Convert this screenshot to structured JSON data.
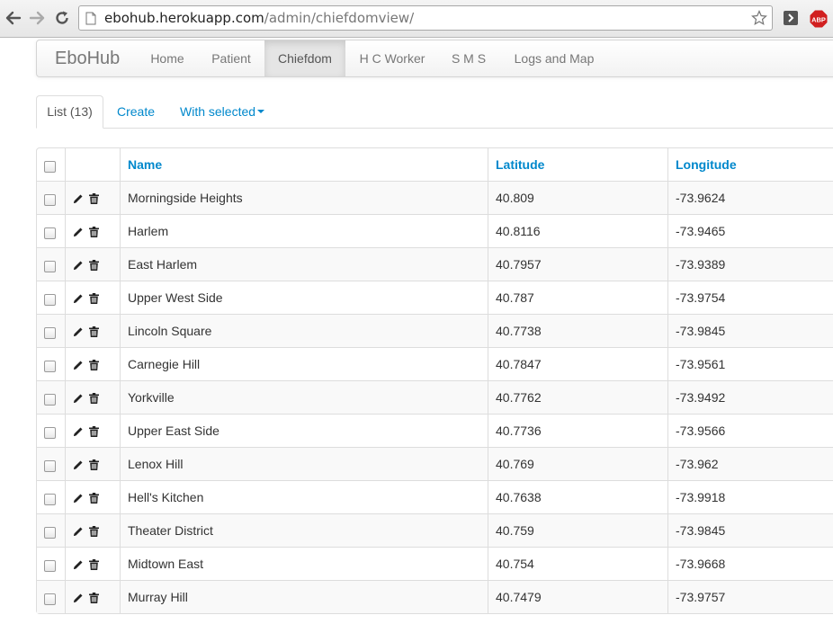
{
  "browser": {
    "url_host": "ebohub.herokuapp.com",
    "url_path": "/admin/chiefdomview/",
    "extension_label": "ABP",
    "icons": {
      "back": "back-arrow-icon",
      "forward": "forward-arrow-icon",
      "reload": "reload-icon",
      "page": "page-icon",
      "bookmark": "star-icon",
      "extension": "extension-icon",
      "adblock": "adblock-icon"
    },
    "colors": {
      "adblock": "#d11f1f"
    }
  },
  "navbar": {
    "brand": "EboHub",
    "items": [
      {
        "label": "Home",
        "active": false
      },
      {
        "label": "Patient",
        "active": false
      },
      {
        "label": "Chiefdom",
        "active": true
      },
      {
        "label": "H C Worker",
        "active": false
      },
      {
        "label": "S M S",
        "active": false
      },
      {
        "label": "Logs and Map",
        "active": false
      }
    ]
  },
  "tabs": {
    "list_label": "List (13)",
    "create_label": "Create",
    "with_selected_label": "With selected"
  },
  "table": {
    "columns": [
      "Name",
      "Latitude",
      "Longitude"
    ],
    "action_icons": [
      "pencil-icon",
      "trash-icon"
    ],
    "rows": [
      {
        "name": "Morningside Heights",
        "latitude": "40.809",
        "longitude": "-73.9624"
      },
      {
        "name": "Harlem",
        "latitude": "40.8116",
        "longitude": "-73.9465"
      },
      {
        "name": "East Harlem",
        "latitude": "40.7957",
        "longitude": "-73.9389"
      },
      {
        "name": "Upper West Side",
        "latitude": "40.787",
        "longitude": "-73.9754"
      },
      {
        "name": "Lincoln Square",
        "latitude": "40.7738",
        "longitude": "-73.9845"
      },
      {
        "name": "Carnegie Hill",
        "latitude": "40.7847",
        "longitude": "-73.9561"
      },
      {
        "name": "Yorkville",
        "latitude": "40.7762",
        "longitude": "-73.9492"
      },
      {
        "name": "Upper East Side",
        "latitude": "40.7736",
        "longitude": "-73.9566"
      },
      {
        "name": "Lenox Hill",
        "latitude": "40.769",
        "longitude": "-73.962"
      },
      {
        "name": "Hell's Kitchen",
        "latitude": "40.7638",
        "longitude": "-73.9918"
      },
      {
        "name": "Theater District",
        "latitude": "40.759",
        "longitude": "-73.9845"
      },
      {
        "name": "Midtown East",
        "latitude": "40.754",
        "longitude": "-73.9668"
      },
      {
        "name": "Murray Hill",
        "latitude": "40.7479",
        "longitude": "-73.9757"
      }
    ]
  },
  "colors": {
    "link": "#0088cc",
    "active_nav_bg": "#e5e5e5",
    "stripe": "#f9f9f9",
    "border": "#dddddd"
  }
}
